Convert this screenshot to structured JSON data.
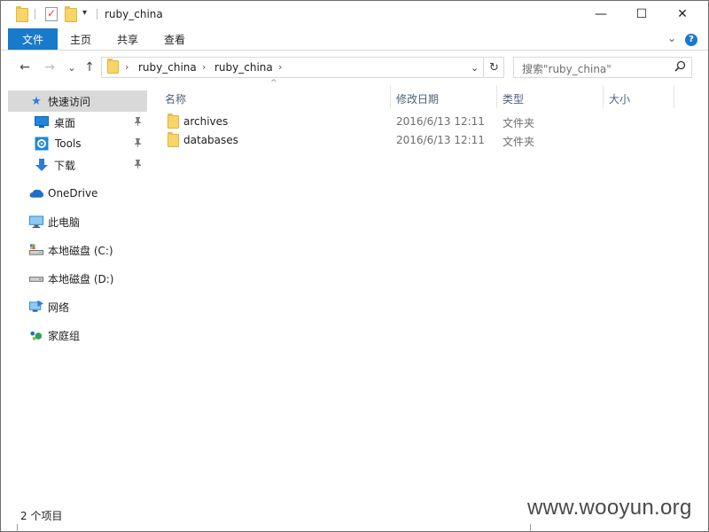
{
  "window": {
    "title": "ruby_china",
    "controls": {
      "minimize": "—",
      "maximize": "☐",
      "close": "✕"
    }
  },
  "ribbon": {
    "tabs": [
      "文件",
      "主页",
      "共享",
      "查看"
    ],
    "expand_icon": "chevron-down-icon",
    "help_icon": "help-icon",
    "help_glyph": "?"
  },
  "nav": {
    "back": "←",
    "forward": "→",
    "recent": "⌄",
    "up": "↑"
  },
  "address": {
    "crumbs": [
      "ruby_china",
      "ruby_china"
    ],
    "separator": "›",
    "refresh": "↻"
  },
  "search": {
    "placeholder": "搜索\"ruby_china\"",
    "icon_glyph": "⚲"
  },
  "sidebar": {
    "items": [
      {
        "label": "快速访问",
        "icon": "star-icon",
        "glyph": "★",
        "color": "#2f7bd6",
        "selected": true,
        "pinned": false
      },
      {
        "label": "桌面",
        "icon": "desktop-icon",
        "glyph": "▭",
        "color": "#1d87dc",
        "pinned": true
      },
      {
        "label": "Tools",
        "icon": "tools-gear-icon",
        "glyph": "⚙",
        "color": "#1d87dc",
        "pinned": true
      },
      {
        "label": "下载",
        "icon": "download-icon",
        "glyph": "⬇",
        "color": "#2f7bd6",
        "pinned": true
      },
      {
        "label": "OneDrive",
        "icon": "cloud-icon",
        "glyph": "☁",
        "color": "#1e6fc7"
      },
      {
        "label": "此电脑",
        "icon": "computer-icon",
        "glyph": "▭",
        "color": "#1d87dc"
      },
      {
        "label": "本地磁盘 (C:)",
        "icon": "drive-c-icon",
        "glyph": "▬",
        "color": "#6b6b6b"
      },
      {
        "label": "本地磁盘 (D:)",
        "icon": "drive-d-icon",
        "glyph": "▬",
        "color": "#6b6b6b"
      },
      {
        "label": "网络",
        "icon": "network-icon",
        "glyph": "▭",
        "color": "#1d87dc"
      },
      {
        "label": "家庭组",
        "icon": "homegroup-icon",
        "glyph": "●",
        "color": "#2f9e5c"
      }
    ],
    "pin_glyph": "📌"
  },
  "table": {
    "columns": [
      "名称",
      "修改日期",
      "类型",
      "大小"
    ],
    "sort_glyph": "^",
    "rows": [
      {
        "name": "archives",
        "date": "2016/6/13 12:11",
        "type": "文件夹",
        "size": ""
      },
      {
        "name": "databases",
        "date": "2016/6/13 12:11",
        "type": "文件夹",
        "size": ""
      }
    ]
  },
  "status": {
    "count": "2 个项目"
  },
  "watermark": "www.wooyun.org",
  "colors": {
    "accent": "#1979ca",
    "selected_bg": "#d9d9d9",
    "folder": "#f7d56b"
  }
}
